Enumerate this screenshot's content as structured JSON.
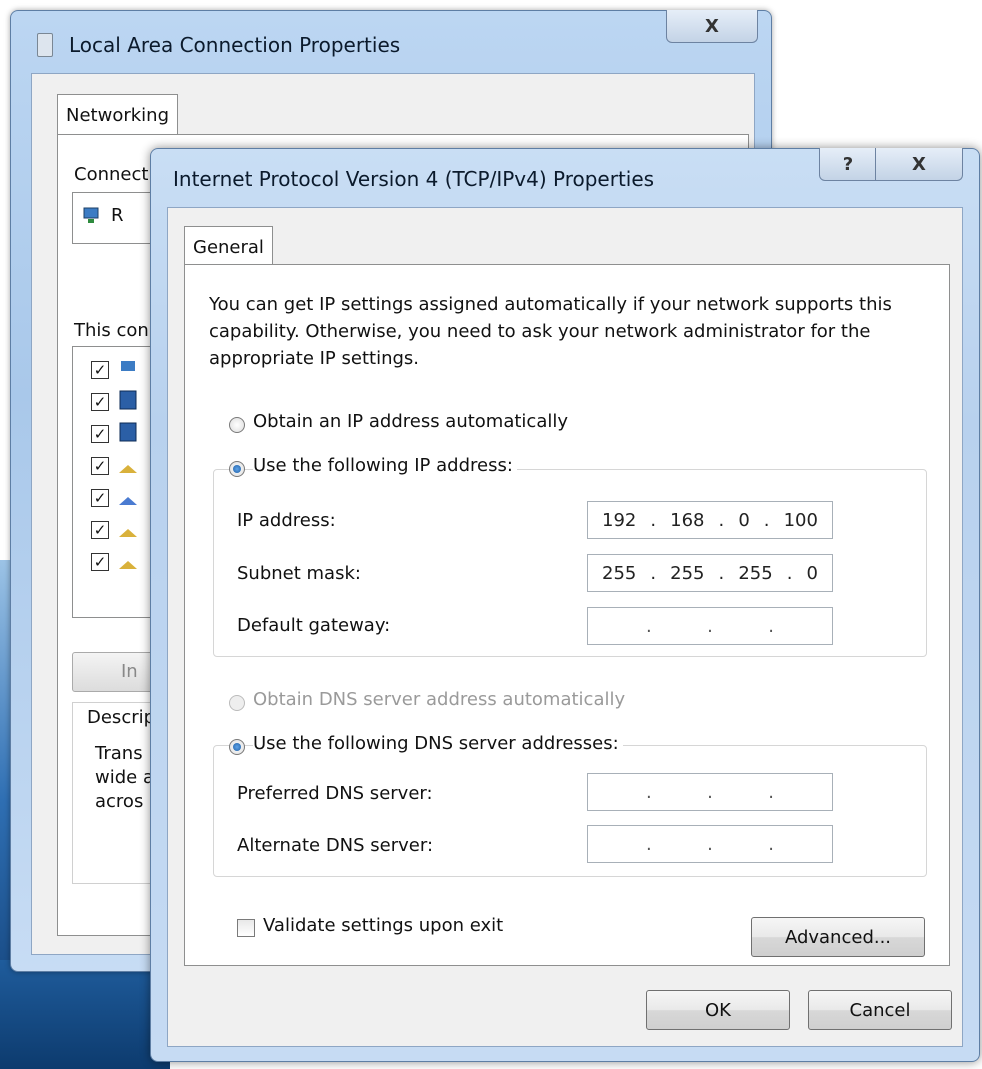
{
  "back_window": {
    "title": "Local Area Connection Properties",
    "close_glyph": "X",
    "tab": "Networking",
    "connect_label": "Connect",
    "adapter_partial": "R",
    "this_conn_label": "This con",
    "install_partial": "In",
    "desc_label": "Descrip",
    "desc_lines": [
      "Trans",
      "wide a",
      "acros"
    ]
  },
  "dialog": {
    "title": "Internet Protocol Version 4 (TCP/IPv4) Properties",
    "help_glyph": "?",
    "close_glyph": "X",
    "tab": "General",
    "intro": "You can get IP settings assigned automatically if your network supports this capability. Otherwise, you need to ask your network administrator for the appropriate IP settings.",
    "ip_section": {
      "auto_label": "Obtain an IP address automatically",
      "manual_label": "Use the following IP address:",
      "fields": [
        {
          "label": "IP address:",
          "octets": [
            "192",
            "168",
            "0",
            "100"
          ]
        },
        {
          "label": "Subnet mask:",
          "octets": [
            "255",
            "255",
            "255",
            "0"
          ]
        },
        {
          "label": "Default gateway:",
          "octets": [
            "",
            "",
            "",
            ""
          ]
        }
      ]
    },
    "dns_section": {
      "auto_label": "Obtain DNS server address automatically",
      "manual_label": "Use the following DNS server addresses:",
      "fields": [
        {
          "label": "Preferred DNS server:",
          "octets": [
            "",
            "",
            "",
            ""
          ]
        },
        {
          "label": "Alternate DNS server:",
          "octets": [
            "",
            "",
            "",
            ""
          ]
        }
      ]
    },
    "validate_label": "Validate settings upon exit",
    "advanced_label": "Advanced...",
    "ok_label": "OK",
    "cancel_label": "Cancel"
  }
}
